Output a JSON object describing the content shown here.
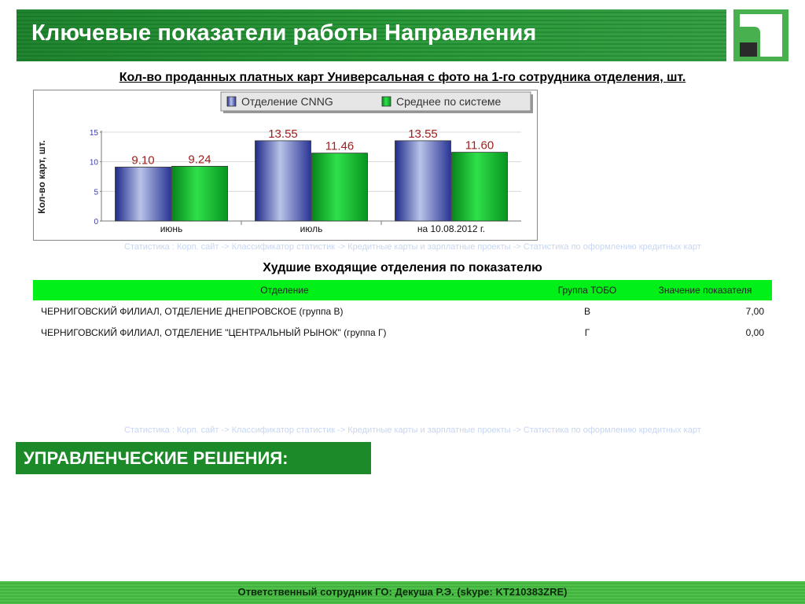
{
  "header": {
    "title": "Ключевые показатели работы Направления"
  },
  "chart": {
    "title": "Кол-во проданных платных карт Универсальная с фото на 1-го сотрудника отделения, шт."
  },
  "chart_data": {
    "type": "bar",
    "categories": [
      "июнь",
      "июль",
      "на 10.08.2012 г."
    ],
    "series": [
      {
        "name": "Отделение CNNG",
        "values": [
          9.1,
          13.55,
          13.55
        ],
        "labels": [
          "9.10",
          "13.55",
          "13.55"
        ],
        "color": "#3a44a8"
      },
      {
        "name": "Среднее по системе",
        "values": [
          9.24,
          11.46,
          11.6
        ],
        "labels": [
          "9.24",
          "11.46",
          "11.60"
        ],
        "color": "#0fb020"
      }
    ],
    "ylabel": "Кол-во карт, шт.",
    "ylim": [
      0,
      15
    ],
    "yticks": [
      "0",
      "5",
      "10",
      "15"
    ],
    "grid": true,
    "legend": "top"
  },
  "links": {
    "breadcrumb_top": "Статистика : Корп. сайт -> Классификатор статистик -> Кредитные карты и зарплатные проекты -> Статистика по оформлению кредитных карт",
    "breadcrumb_bottom": "Статистика : Корп. сайт -> Классификатор статистик -> Кредитные карты и зарплатные проекты -> Статистика по оформлению кредитных карт"
  },
  "worst": {
    "title": "Худшие входящие отделения по показателю",
    "columns": [
      "Отделение",
      "Группа ТОБО",
      "Значение показателя"
    ],
    "rows": [
      [
        "ЧЕРНИГОВСКИЙ ФИЛИАЛ, ОТДЕЛЕНИЕ ДНЕПРОВСКОЕ (группа В)",
        "В",
        "7,00"
      ],
      [
        "ЧЕРНИГОВСКИЙ ФИЛИАЛ, ОТДЕЛЕНИЕ \"ЦЕНТРАЛЬНЫЙ РЫНОК\" (группа Г)",
        "Г",
        "0,00"
      ]
    ]
  },
  "decisions": {
    "title": "УПРАВЛЕНЧЕСКИЕ РЕШЕНИЯ:"
  },
  "footer": {
    "text": "Ответственный сотрудник ГО: Декуша Р.Э. (skype: KT210383ZRE)"
  },
  "colors": {
    "brand_green": "#1d8a2a",
    "table_header": "#00f018",
    "bar_series1": "#3a44a8",
    "bar_series2": "#0fb020"
  }
}
